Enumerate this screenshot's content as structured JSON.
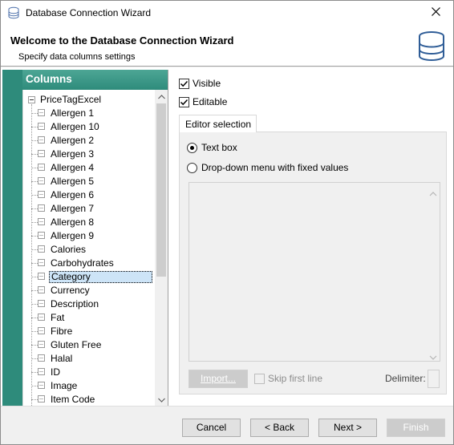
{
  "window": {
    "title": "Database Connection Wizard",
    "close_glyph": "✕"
  },
  "header": {
    "title": "Welcome to the Database Connection Wizard",
    "subtitle": "Specify data columns settings",
    "icon": "database-icon"
  },
  "left_panel": {
    "header": "Columns",
    "root": "PriceTagExcel",
    "items": [
      "Allergen 1",
      "Allergen 10",
      "Allergen 2",
      "Allergen 3",
      "Allergen 4",
      "Allergen 5",
      "Allergen 6",
      "Allergen 7",
      "Allergen 8",
      "Allergen 9",
      "Calories",
      "Carbohydrates",
      "Category",
      "Currency",
      "Description",
      "Fat",
      "Fibre",
      "Gluten Free",
      "Halal",
      "ID",
      "Image",
      "Item Code"
    ],
    "selected_item": "Category"
  },
  "settings": {
    "visible_label": "Visible",
    "visible_checked": true,
    "editable_label": "Editable",
    "editable_checked": true,
    "tab_label": "Editor selection",
    "radio_textbox": "Text box",
    "radio_dropdown": "Drop-down menu with fixed values",
    "selected_editor": "Text box",
    "import_button": "Import...",
    "skip_first_line": "Skip first line",
    "delimiter_label": "Delimiter:",
    "delimiter_value": ""
  },
  "footer": {
    "cancel": "Cancel",
    "back": "< Back",
    "next": "Next >",
    "finish": "Finish"
  },
  "colors": {
    "accent_teal": "#2e8b7b",
    "selection": "#cde4f7"
  }
}
